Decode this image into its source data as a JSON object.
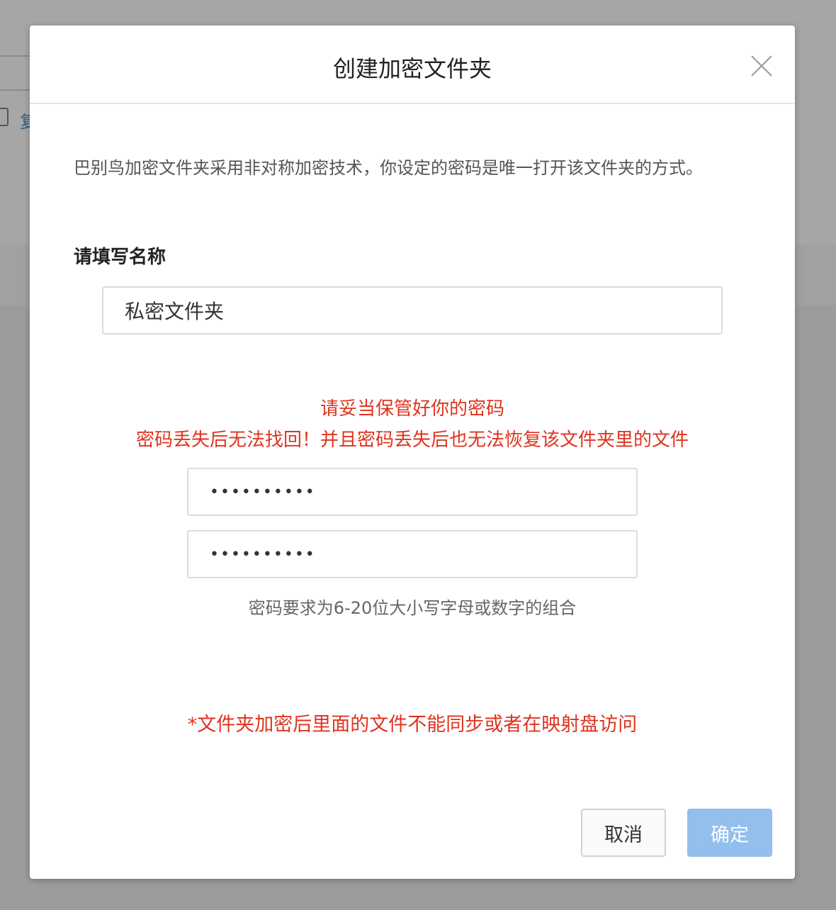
{
  "background": {
    "partial_char": "复"
  },
  "dialog": {
    "title": "创建加密文件夹",
    "description": "巴别鸟加密文件夹采用非对称加密技术，你设定的密码是唯一打开该文件夹的方式。",
    "name_label": "请填写名称",
    "name_value": "私密文件夹",
    "warning_line1": "请妥当保管好你的密码",
    "warning_line2": "密码丢失后无法找回！并且密码丢失后也无法恢复该文件夹里的文件",
    "password_value": "••••••••••",
    "confirm_password_value": "••••••••••",
    "password_hint": "密码要求为6-20位大小写字母或数字的组合",
    "notice": "*文件夹加密后里面的文件不能同步或者在映射盘访问",
    "cancel_label": "取消",
    "confirm_label": "确定"
  },
  "colors": {
    "warning": "#e0331f",
    "primary_disabled": "#92bfec",
    "overlay": "#9c9c9c"
  }
}
